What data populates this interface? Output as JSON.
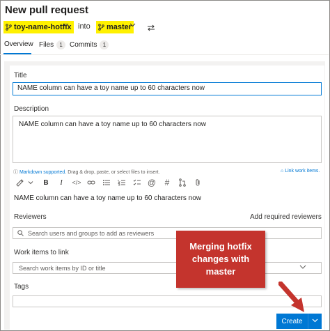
{
  "page": {
    "title": "New pull request"
  },
  "branches": {
    "source": "toy-name-hotfix",
    "into_label": "into",
    "target": "master",
    "highlight_color": "#fff100"
  },
  "tabs": [
    {
      "label": "Overview"
    },
    {
      "label": "Files",
      "count": "1"
    },
    {
      "label": "Commits",
      "count": "1"
    }
  ],
  "form": {
    "title_label": "Title",
    "title_value": "NAME column can have a toy name up to 60 characters now",
    "description_label": "Description",
    "description_value": "NAME column can have a toy name up to 60 characters now",
    "markdown_link": "Markdown supported.",
    "drag_hint": "Drag & drop, paste, or select files to insert.",
    "link_work_items": "Link work items.",
    "preview_text": "NAME column can have a toy name up to 60 characters now",
    "reviewers_label": "Reviewers",
    "add_required_reviewers": "Add required reviewers",
    "reviewers_placeholder": "Search users and groups to add as reviewers",
    "work_items_label": "Work items to link",
    "work_items_placeholder": "Search work items by ID or title",
    "tags_label": "Tags"
  },
  "toolbar_icons": [
    "format-icon",
    "bold-icon",
    "italic-icon",
    "code-icon",
    "link-icon",
    "bulleted-list-icon",
    "numbered-list-icon",
    "checklist-icon",
    "mention-icon",
    "hash-icon",
    "pull-request-icon",
    "attach-icon"
  ],
  "callout": {
    "text": "Merging hotfix changes with master",
    "color": "#c4342d"
  },
  "actions": {
    "create_label": "Create",
    "accent": "#0078d4"
  }
}
